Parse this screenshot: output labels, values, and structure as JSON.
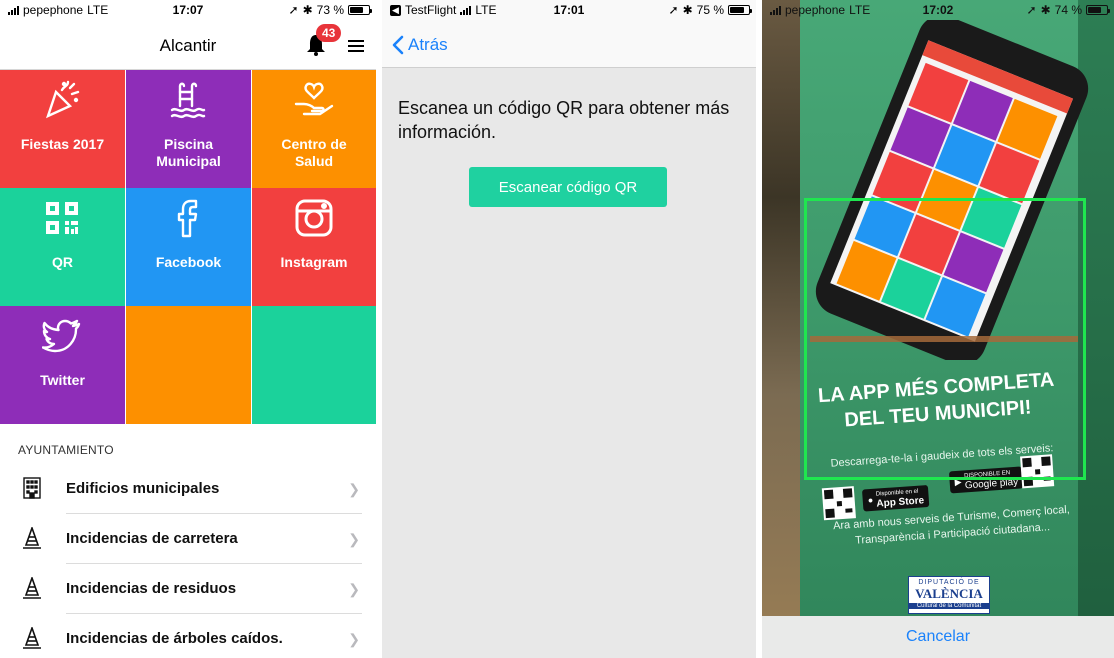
{
  "screen1": {
    "status": {
      "carrier": "pepephone",
      "network": "LTE",
      "time": "17:07",
      "battery": "73 %",
      "battery_level": 0.73
    },
    "header": {
      "title": "Alcantir",
      "notification_count": "43"
    },
    "tiles": [
      {
        "label_line1": "Fiestas 2017",
        "label_line2": "",
        "color": "#f2403f",
        "icon": "party-popper-icon"
      },
      {
        "label_line1": "Piscina",
        "label_line2": "Municipal",
        "color": "#8e2db8",
        "icon": "pool-icon"
      },
      {
        "label_line1": "Centro de",
        "label_line2": "Salud",
        "color": "#fd9000",
        "icon": "heart-hand-icon"
      },
      {
        "label_line1": "QR",
        "label_line2": "",
        "color": "#1bd29b",
        "icon": "qr-code-icon"
      },
      {
        "label_line1": "Facebook",
        "label_line2": "",
        "color": "#2196f3",
        "icon": "facebook-icon"
      },
      {
        "label_line1": "Instagram",
        "label_line2": "",
        "color": "#f2403f",
        "icon": "instagram-icon"
      },
      {
        "label_line1": "Twitter",
        "label_line2": "",
        "color": "#8e2db8",
        "icon": "twitter-icon"
      },
      {
        "label_line1": "",
        "label_line2": "",
        "color": "#fd9000",
        "icon": ""
      },
      {
        "label_line1": "",
        "label_line2": "",
        "color": "#1bd29b",
        "icon": ""
      }
    ],
    "section_header": "AYUNTAMIENTO",
    "list": [
      {
        "label": "Edificios municipales",
        "icon": "building-icon"
      },
      {
        "label": "Incidencias de carretera",
        "icon": "traffic-cone-icon"
      },
      {
        "label": "Incidencias de residuos",
        "icon": "traffic-cone-icon"
      },
      {
        "label": "Incidencias de árboles caídos.",
        "icon": "traffic-cone-icon"
      }
    ]
  },
  "screen2": {
    "status": {
      "app": "TestFlight",
      "network": "LTE",
      "time": "17:01",
      "battery": "75 %",
      "battery_level": 0.75
    },
    "back_label": "Atrás",
    "intro": "Escanea un código QR para obtener más información.",
    "scan_button": "Escanear código QR",
    "accent": "#1fd1a0"
  },
  "screen3": {
    "status": {
      "carrier": "pepephone",
      "network": "LTE",
      "time": "17:02",
      "battery": "74 %",
      "battery_level": 0.74
    },
    "poster": {
      "headline_line1": "LA APP MÉS COMPLETA",
      "headline_line2": "DEL TEU MUNICIPI!",
      "subline": "Descarrega-te-la i gaudeix de tots els serveis:",
      "app_store": "App Store",
      "app_store_pre": "Disponible en el",
      "google_play": "Google play",
      "google_play_pre": "DISPONIBLE EN",
      "footer": "Ara amb nous serveis de Turisme, Comerç local, Transparència i Participació ciutadana...",
      "dipu_line1": "DIPUTACIÓ DE",
      "dipu_line2": "VALÈNCIA",
      "dipu_line3": "Cultural de la Comunitat"
    },
    "cancel_label": "Cancelar"
  }
}
